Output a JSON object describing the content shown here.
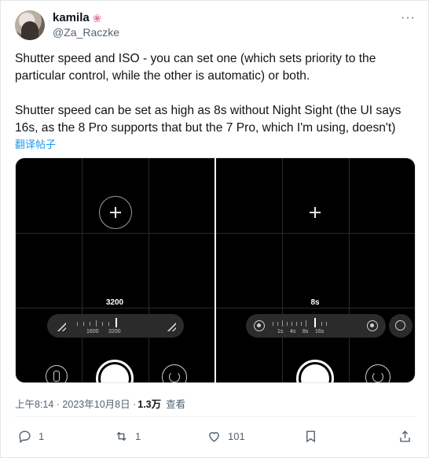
{
  "author": {
    "display_name": "kamila",
    "emoji_icon": "flower-icon",
    "handle": "@Za_Raczke"
  },
  "tweet": {
    "paragraph_1": "Shutter speed and ISO - you can set one (which sets priority to the particular control, while the other is automatic) or both.",
    "paragraph_2": "Shutter speed can be set as high as 8s without Night Sight (the UI says 16s, as the 8 Pro supports that but the 7 Pro, which I'm using, doesn't)",
    "translate_label": "翻译帖子"
  },
  "media": {
    "left": {
      "value": "3200",
      "tick_labels": [
        "1600",
        "3200"
      ]
    },
    "right": {
      "value": "8s",
      "tick_labels": [
        "1s",
        "4s",
        "8s",
        "16s"
      ]
    }
  },
  "meta": {
    "timestamp": "上午8:14 · 2023年10月8日 ·",
    "views_count": "1.3万",
    "views_label": "查看"
  },
  "actions": {
    "reply_count": "1",
    "retweet_count": "1",
    "like_count": "101"
  },
  "colors": {
    "link": "#1d9bf0",
    "muted": "#536471",
    "text": "#0f1419"
  }
}
